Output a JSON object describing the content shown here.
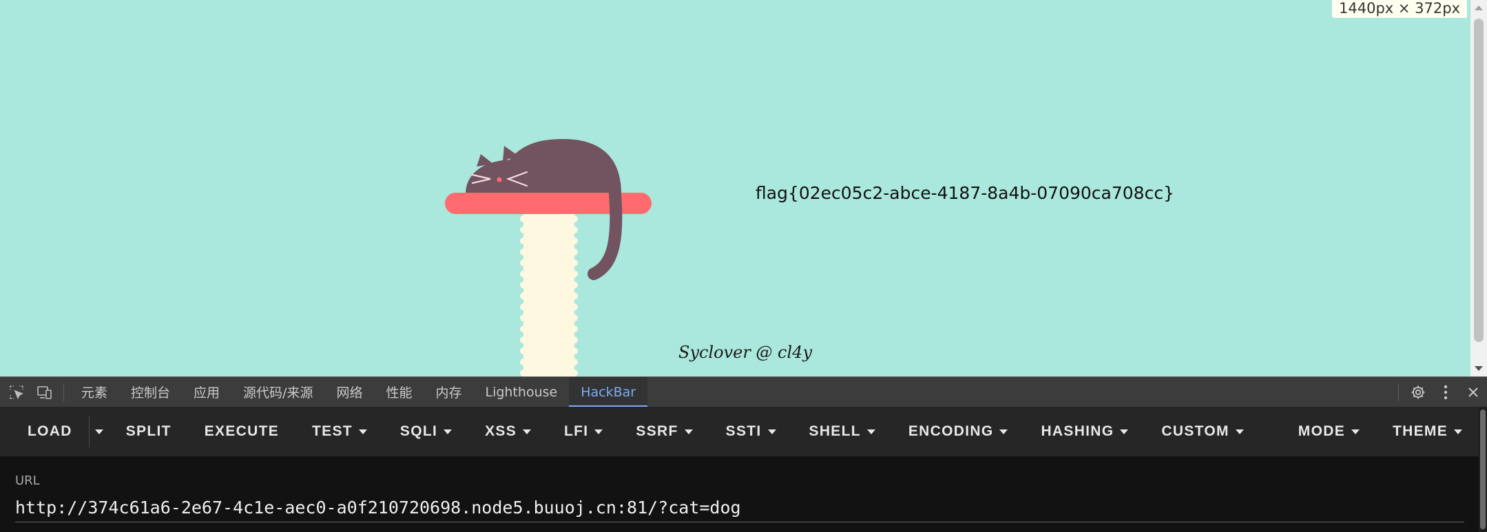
{
  "viewport": {
    "dimension_badge": "1440px × 372px",
    "flag": "flag{02ec05c2-abce-4187-8a4b-07090ca708cc}",
    "credit": "Syclover @ cl4y",
    "background": "#aae7dc"
  },
  "devtools": {
    "icons": [
      "inspect-element-icon",
      "device-toolbar-icon"
    ],
    "tabs": [
      {
        "label": "元素"
      },
      {
        "label": "控制台"
      },
      {
        "label": "应用"
      },
      {
        "label": "源代码/来源"
      },
      {
        "label": "网络"
      },
      {
        "label": "性能"
      },
      {
        "label": "内存"
      },
      {
        "label": "Lighthouse"
      },
      {
        "label": "HackBar",
        "active": true
      }
    ],
    "right_icons": [
      "settings-icon",
      "more-options-icon",
      "close-icon"
    ],
    "accent": "#7cacf8"
  },
  "hackbar": {
    "buttons": {
      "load": "LOAD",
      "split": "SPLIT",
      "execute": "EXECUTE",
      "test": "TEST",
      "sqli": "SQLI",
      "xss": "XSS",
      "lfi": "LFI",
      "ssrf": "SSRF",
      "ssti": "SSTI",
      "shell": "SHELL",
      "encoding": "ENCODING",
      "hashing": "HASHING",
      "custom": "CUSTOM",
      "mode": "MODE",
      "theme": "THEME"
    },
    "url_label": "URL",
    "url_value": "http://374c61a6-2e67-4c1e-aec0-a0f210720698.node5.buuoj.cn:81/?cat=dog"
  },
  "colors": {
    "cat": "#725360",
    "perch": "#ff6b6e",
    "post": "#fff8e1"
  }
}
